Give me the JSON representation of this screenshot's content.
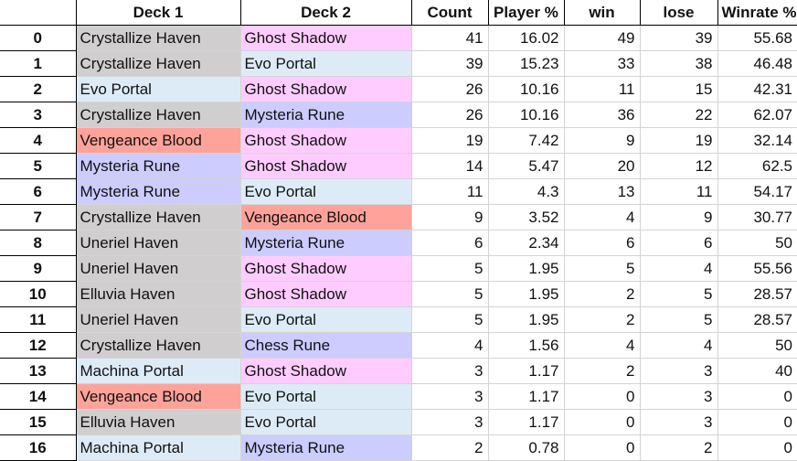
{
  "columns": [
    "",
    "Deck 1",
    "Deck 2",
    "Count",
    "Player %",
    "win",
    "lose",
    "Winrate %"
  ],
  "deck_colors": {
    "Crystallize Haven": "#d0cece",
    "Uneriel Haven": "#d0cece",
    "Elluvia Haven": "#d0cece",
    "Ghost Shadow": "#ffccff",
    "Evo Portal": "#ddebf7",
    "Machina Portal": "#ddebf7",
    "Mysteria Rune": "#ccccff",
    "Chess Rune": "#ccccff",
    "Vengeance Blood": "#ffa39a"
  },
  "rows": [
    {
      "idx": "0",
      "deck1": "Crystallize Haven",
      "deck2": "Ghost Shadow",
      "count": "41",
      "player_pct": "16.02",
      "win": "49",
      "lose": "39",
      "winrate": "55.68"
    },
    {
      "idx": "1",
      "deck1": "Crystallize Haven",
      "deck2": "Evo Portal",
      "count": "39",
      "player_pct": "15.23",
      "win": "33",
      "lose": "38",
      "winrate": "46.48"
    },
    {
      "idx": "2",
      "deck1": "Evo Portal",
      "deck2": "Ghost Shadow",
      "count": "26",
      "player_pct": "10.16",
      "win": "11",
      "lose": "15",
      "winrate": "42.31"
    },
    {
      "idx": "3",
      "deck1": "Crystallize Haven",
      "deck2": "Mysteria Rune",
      "count": "26",
      "player_pct": "10.16",
      "win": "36",
      "lose": "22",
      "winrate": "62.07"
    },
    {
      "idx": "4",
      "deck1": "Vengeance Blood",
      "deck2": "Ghost Shadow",
      "count": "19",
      "player_pct": "7.42",
      "win": "9",
      "lose": "19",
      "winrate": "32.14"
    },
    {
      "idx": "5",
      "deck1": "Mysteria Rune",
      "deck2": "Ghost Shadow",
      "count": "14",
      "player_pct": "5.47",
      "win": "20",
      "lose": "12",
      "winrate": "62.5"
    },
    {
      "idx": "6",
      "deck1": "Mysteria Rune",
      "deck2": "Evo Portal",
      "count": "11",
      "player_pct": "4.3",
      "win": "13",
      "lose": "11",
      "winrate": "54.17"
    },
    {
      "idx": "7",
      "deck1": "Crystallize Haven",
      "deck2": "Vengeance Blood",
      "count": "9",
      "player_pct": "3.52",
      "win": "4",
      "lose": "9",
      "winrate": "30.77"
    },
    {
      "idx": "8",
      "deck1": "Uneriel Haven",
      "deck2": "Mysteria Rune",
      "count": "6",
      "player_pct": "2.34",
      "win": "6",
      "lose": "6",
      "winrate": "50"
    },
    {
      "idx": "9",
      "deck1": "Uneriel Haven",
      "deck2": "Ghost Shadow",
      "count": "5",
      "player_pct": "1.95",
      "win": "5",
      "lose": "4",
      "winrate": "55.56"
    },
    {
      "idx": "10",
      "deck1": "Elluvia Haven",
      "deck2": "Ghost Shadow",
      "count": "5",
      "player_pct": "1.95",
      "win": "2",
      "lose": "5",
      "winrate": "28.57"
    },
    {
      "idx": "11",
      "deck1": "Uneriel Haven",
      "deck2": "Evo Portal",
      "count": "5",
      "player_pct": "1.95",
      "win": "2",
      "lose": "5",
      "winrate": "28.57"
    },
    {
      "idx": "12",
      "deck1": "Crystallize Haven",
      "deck2": "Chess Rune",
      "count": "4",
      "player_pct": "1.56",
      "win": "4",
      "lose": "4",
      "winrate": "50"
    },
    {
      "idx": "13",
      "deck1": "Machina Portal",
      "deck2": "Ghost Shadow",
      "count": "3",
      "player_pct": "1.17",
      "win": "2",
      "lose": "3",
      "winrate": "40"
    },
    {
      "idx": "14",
      "deck1": "Vengeance Blood",
      "deck2": "Evo Portal",
      "count": "3",
      "player_pct": "1.17",
      "win": "0",
      "lose": "3",
      "winrate": "0"
    },
    {
      "idx": "15",
      "deck1": "Elluvia Haven",
      "deck2": "Evo Portal",
      "count": "3",
      "player_pct": "1.17",
      "win": "0",
      "lose": "3",
      "winrate": "0"
    },
    {
      "idx": "16",
      "deck1": "Machina Portal",
      "deck2": "Mysteria Rune",
      "count": "2",
      "player_pct": "0.78",
      "win": "0",
      "lose": "2",
      "winrate": "0"
    }
  ]
}
